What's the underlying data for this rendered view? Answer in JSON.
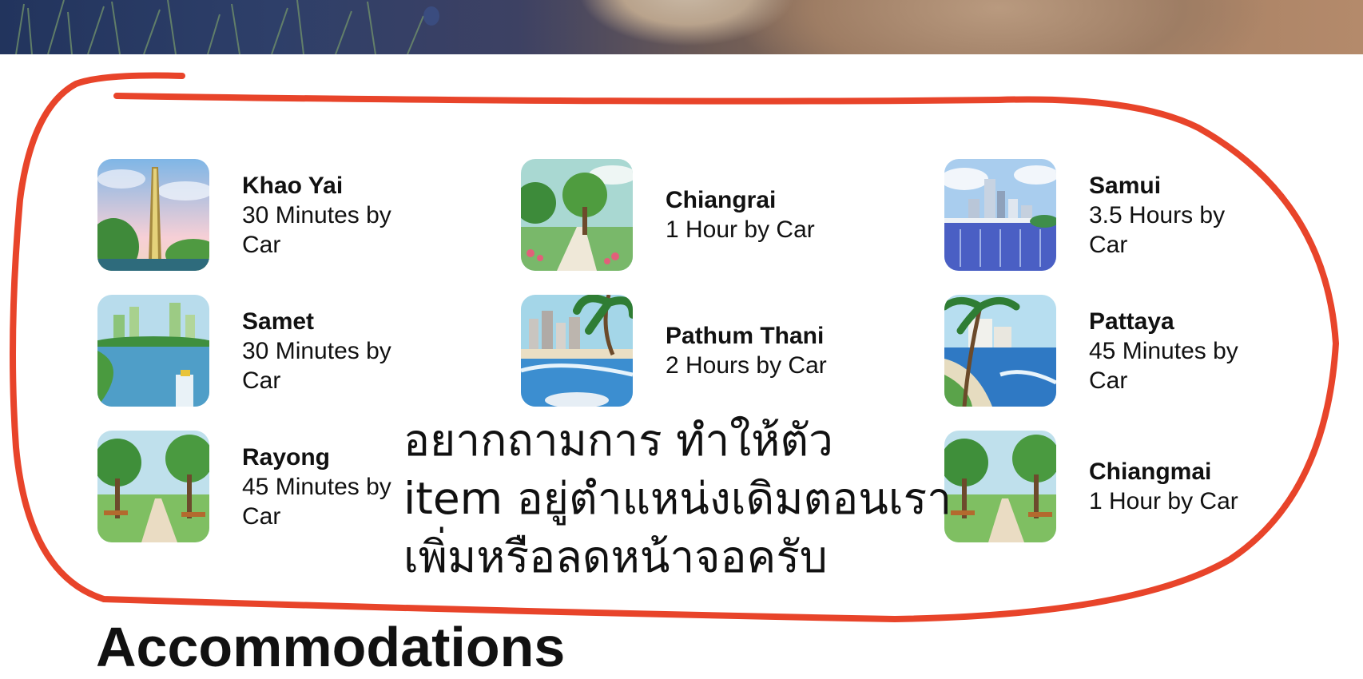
{
  "destinations": [
    {
      "name": "Khao Yai",
      "duration": "30 Minutes by Car",
      "thumb": "tower-icon"
    },
    {
      "name": "Chiangrai",
      "duration": "1 Hour by Car",
      "thumb": "park-path-icon"
    },
    {
      "name": "Samui",
      "duration": "3.5 Hours by Car",
      "thumb": "city-bridge-icon"
    },
    {
      "name": "Samet",
      "duration": "30 Minutes by Car",
      "thumb": "city-river-icon"
    },
    {
      "name": "Pathum Thani",
      "duration": "2 Hours by Car",
      "thumb": "beach-city-icon"
    },
    {
      "name": "Pattaya",
      "duration": "45 Minutes by Car",
      "thumb": "palm-beach-icon"
    },
    {
      "name": "Rayong",
      "duration": "45 Minutes by Car",
      "thumb": "forest-bench-icon"
    },
    {
      "name": "Chiangmai",
      "duration": "1 Hour by Car",
      "thumb": "forest-bench-icon"
    }
  ],
  "annotation": {
    "question": "อยากถามการ ทำให้ตัว\nitem อยู่ตำแหน่งเดิมตอนเรา\nเพิ่มหรือลดหน้าจอครับ",
    "marker_color": "#e8442a"
  },
  "next_section": {
    "heading": "Accommodations"
  }
}
